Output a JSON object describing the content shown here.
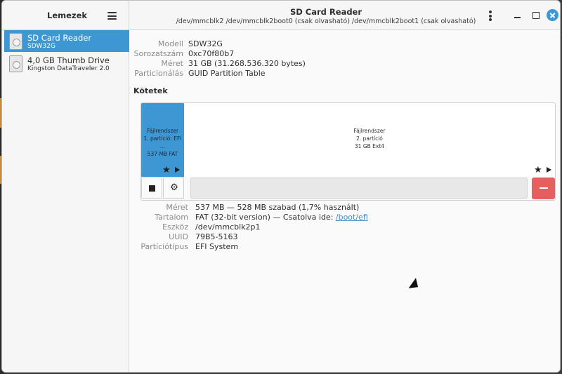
{
  "sidebar": {
    "title": "Lemezek",
    "drives": [
      {
        "name": "SD Card Reader",
        "subtitle": "SDW32G"
      },
      {
        "name": "4,0 GB Thumb Drive",
        "subtitle": "Kingston DataTraveler 2.0"
      }
    ]
  },
  "header": {
    "title": "SD Card Reader",
    "subtitle": "/dev/mmcblk2 /dev/mmcblk2boot0 (csak olvasható) /dev/mmcblk2boot1 (csak olvasható)"
  },
  "drive_info": [
    {
      "label": "Modell",
      "value": "SDW32G"
    },
    {
      "label": "Sorozatszám",
      "value": "0xc70f80b7"
    },
    {
      "label": "Méret",
      "value": "31 GB (31.268.536.320 bytes)"
    },
    {
      "label": "Particionálás",
      "value": "GUID Partition Table"
    }
  ],
  "volumes": {
    "title": "Kötetek",
    "partitions": [
      {
        "line1": "Fájlrendszer",
        "line2": "1. partíció: EFI ...",
        "line3": "537 MB FAT"
      },
      {
        "line1": "Fájlrendszer",
        "line2": "2. partíció",
        "line3": "31 GB Ext4"
      }
    ]
  },
  "volume_info": {
    "size": {
      "label": "Méret",
      "value": "537 MB — 528 MB szabad (1,7% használt)"
    },
    "contents": {
      "label": "Tartalom",
      "value": "FAT (32-bit version) — Csatolva ide: ",
      "link": "/boot/efi"
    },
    "device": {
      "label": "Eszköz",
      "value": "/dev/mmcblk2p1"
    },
    "uuid": {
      "label": "UUID",
      "value": "79B5-5163"
    },
    "part_type": {
      "label": "Partíciótípus",
      "value": "EFI System"
    }
  },
  "colors": {
    "accent": "#3c97d3",
    "danger": "#e65e5e"
  },
  "icons": {
    "menu": "hamburger-icon",
    "kebab": "vertical-dots-icon",
    "drive": "sd-card-icon",
    "star": "star-icon",
    "play": "play-icon",
    "stop": "stop-icon",
    "gear": "gear-icon",
    "remove": "minus-icon"
  }
}
